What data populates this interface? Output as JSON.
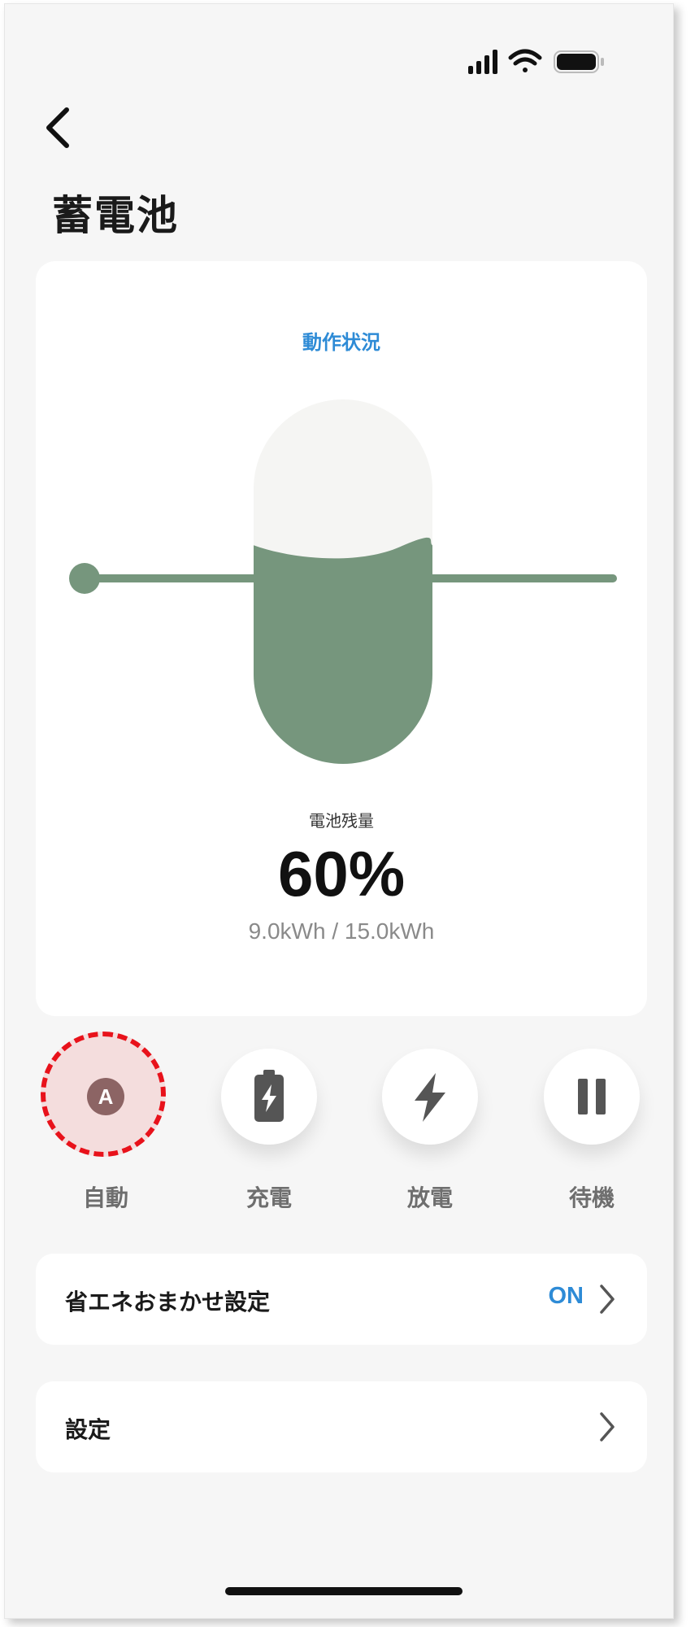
{
  "page": {
    "title": "蓄電池"
  },
  "status_card": {
    "label": "動作状況",
    "remaining_label": "電池残量",
    "charge_fraction": 0.6,
    "percent_text": "60%",
    "capacity_text": "9.0kWh / 15.0kWh",
    "fill_color": "#76967d"
  },
  "modes": [
    {
      "label": "自動",
      "icon": "letter-a-icon",
      "badge": "A",
      "selected": true
    },
    {
      "label": "充電",
      "icon": "battery-charge-icon",
      "selected": false
    },
    {
      "label": "放電",
      "icon": "lightning-icon",
      "selected": false
    },
    {
      "label": "待機",
      "icon": "pause-icon",
      "selected": false
    }
  ],
  "settings_rows": [
    {
      "label": "省エネおまかせ設定",
      "value": "ON"
    },
    {
      "label": "設定",
      "value": ""
    }
  ],
  "colors": {
    "accent": "#2e8bd6",
    "battery_green": "#76967d",
    "highlight": "#e8121b"
  }
}
